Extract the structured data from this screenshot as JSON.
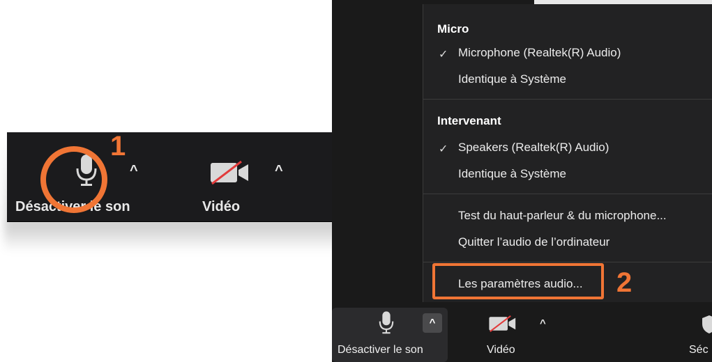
{
  "left_toolbar": {
    "mute_label": "Désactiver le son",
    "video_label": "Vidéo",
    "caret": "^"
  },
  "callouts": {
    "one": "1",
    "two": "2",
    "color": "#f07535"
  },
  "audio_menu": {
    "micro_title": "Micro",
    "micro_items": [
      {
        "label": "Microphone (Realtek(R) Audio)",
        "checked": true
      },
      {
        "label": "Identique à Système",
        "checked": false
      }
    ],
    "speaker_title": "Intervenant",
    "speaker_items": [
      {
        "label": "Speakers (Realtek(R) Audio)",
        "checked": true
      },
      {
        "label": "Identique à Système",
        "checked": false
      }
    ],
    "test_label": "Test du haut-parleur & du microphone...",
    "leave_label": "Quitter l’audio de l’ordinateur",
    "settings_label": "Les paramètres audio...",
    "check_glyph": "✓"
  },
  "right_toolbar": {
    "mute_label": "Désactiver le son",
    "video_label": "Vidéo",
    "security_label": "Séc",
    "caret": "^"
  }
}
